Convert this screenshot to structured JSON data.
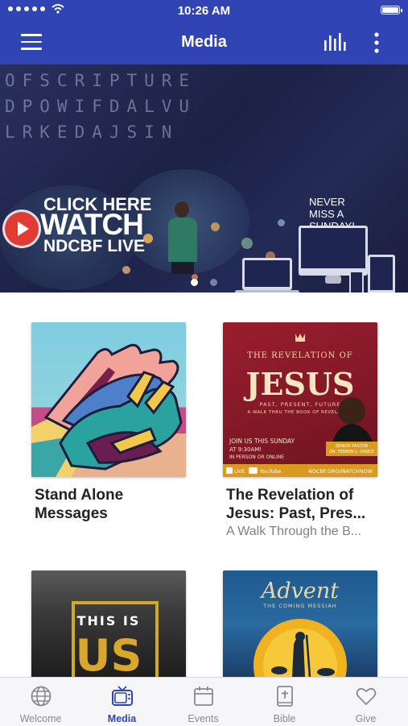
{
  "status_bar": {
    "time": "10:26 AM"
  },
  "header": {
    "title": "Media",
    "menu_icon": "hamburger-menu-icon",
    "stats_icon": "equalizer-icon",
    "more_icon": "more-vertical-icon"
  },
  "banner": {
    "word_grid": [
      "OFSCRIPTURE",
      "DPOWIFDALVU",
      "LRKEDAJSIN"
    ],
    "cta_line1": "CLICK HERE",
    "cta_line2": "WATCH",
    "cta_line3": "NDCBF LIVE",
    "tagline": "NEVER MISS A SUNDAY!",
    "pager": {
      "count": 2,
      "active": 1
    }
  },
  "cards": [
    {
      "title": "Stand Alone Messages",
      "subtitle": ""
    },
    {
      "title": "The Revelation of Jesus: Past, Pres...",
      "subtitle": "A Walk Through the B...",
      "art": {
        "heading": "THE REVELATION OF",
        "big": "JESUS",
        "tagline1": "PAST, PRESENT, FUTURE",
        "tagline2": "A WALK THRU THE BOOK OF REVELATION",
        "join1": "JOIN US THIS SUNDAY",
        "join2": "AT 9:30AM!",
        "join3": "IN PERSON OR ONLINE",
        "pastor_role": "SENIOR PASTOR",
        "pastor_name": "DR. TERREN L. DANCE",
        "live": "LIVE",
        "youtube": "YouTube",
        "url": "NDCBF.ORG/WATCHNOW"
      }
    },
    {
      "title": "",
      "subtitle": "",
      "art": {
        "line1": "THIS IS",
        "line2": "US"
      }
    },
    {
      "title": "",
      "subtitle": "",
      "art": {
        "line1": "Advent",
        "line2": "THE COMING MESSIAH"
      }
    }
  ],
  "tabs": [
    {
      "label": "Welcome",
      "icon": "globe-icon"
    },
    {
      "label": "Media",
      "icon": "tv-icon"
    },
    {
      "label": "Events",
      "icon": "calendar-icon"
    },
    {
      "label": "Bible",
      "icon": "bible-icon"
    },
    {
      "label": "Give",
      "icon": "heart-icon"
    }
  ],
  "colors": {
    "brand": "#3044b4",
    "tab_inactive": "#8a8a8e"
  }
}
